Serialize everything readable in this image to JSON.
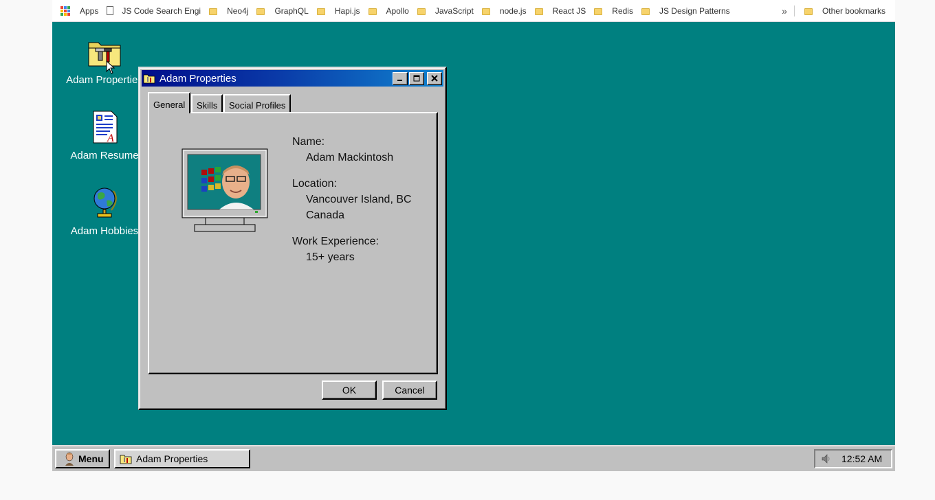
{
  "bookmarks_bar": {
    "apps_label": "Apps",
    "items": [
      "JS Code Search Engi",
      "Neo4j",
      "GraphQL",
      "Hapi.js",
      "Apollo",
      "JavaScript",
      "node.js",
      "React JS",
      "Redis",
      "JS Design Patterns"
    ],
    "overflow": "»",
    "other": "Other bookmarks"
  },
  "desktop": {
    "background": "#008080",
    "icons": [
      {
        "label": "Adam Properties",
        "icon": "properties-folder-icon"
      },
      {
        "label": "Adam Resume",
        "icon": "resume-document-icon"
      },
      {
        "label": "Adam Hobbies",
        "icon": "globe-icon"
      }
    ]
  },
  "dialog": {
    "title": "Adam Properties",
    "tabs": [
      "General",
      "Skills",
      "Social Profiles"
    ],
    "active_tab": "General",
    "fields": {
      "name_label": "Name:",
      "name_value": "Adam Mackintosh",
      "location_label": "Location:",
      "location_line1": "Vancouver Island, BC",
      "location_line2": "Canada",
      "experience_label": "Work Experience:",
      "experience_value": "15+ years"
    },
    "ok_label": "OK",
    "cancel_label": "Cancel",
    "title_gradient": [
      "#000d8a",
      "#1084d0"
    ]
  },
  "taskbar": {
    "menu_label": "Menu",
    "task_label": "Adam Properties",
    "clock": "12:52 AM"
  }
}
